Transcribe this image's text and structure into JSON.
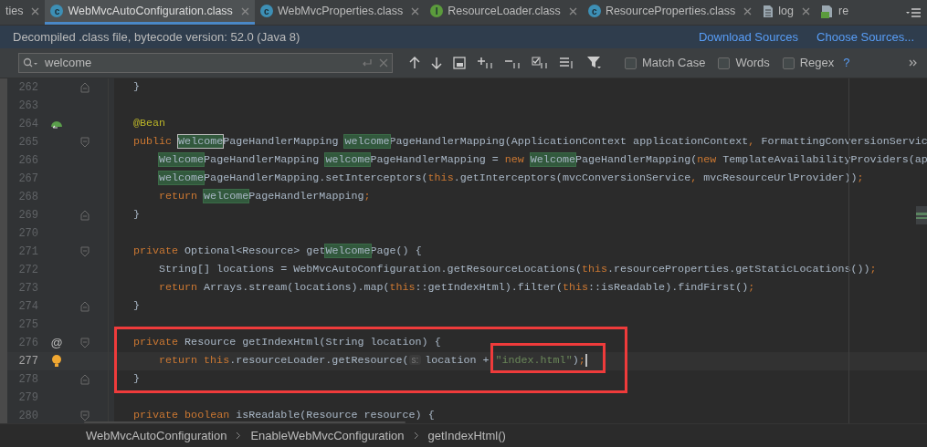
{
  "tabs": [
    {
      "label": "ties",
      "kind": "none",
      "selected": false
    },
    {
      "label": "WebMvcAutoConfiguration.class",
      "kind": "class",
      "icon_letter": "c",
      "selected": true
    },
    {
      "label": "WebMvcProperties.class",
      "kind": "class",
      "icon_letter": "c",
      "selected": false
    },
    {
      "label": "ResourceLoader.class",
      "kind": "interface",
      "icon_letter": "I",
      "selected": false
    },
    {
      "label": "ResourceProperties.class",
      "kind": "class",
      "icon_letter": "c",
      "selected": false
    },
    {
      "label": "log",
      "kind": "file",
      "selected": false
    },
    {
      "label": "re",
      "kind": "html",
      "selected": false
    }
  ],
  "info_bar": {
    "message": "Decompiled .class file, bytecode version: 52.0 (Java 8)",
    "links": [
      "Download Sources",
      "Choose Sources..."
    ]
  },
  "search": {
    "value": "welcome",
    "options": [
      {
        "label": "Match Case",
        "checked": false
      },
      {
        "label": "Words",
        "checked": false
      },
      {
        "label": "Regex",
        "checked": false
      }
    ],
    "help": "?"
  },
  "lines": [
    {
      "number": "262",
      "fold": {
        "kind": "end"
      },
      "segments": [
        {
          "kind": "plain",
          "text": "}"
        }
      ]
    },
    {
      "number": "263"
    },
    {
      "number": "264",
      "marker": {
        "kind": "bean"
      },
      "segments": [
        {
          "kind": "annotation",
          "text": "@Bean"
        }
      ]
    },
    {
      "number": "265",
      "fold": {
        "kind": "start"
      },
      "segments": [
        {
          "kind": "keyword",
          "text": "public "
        },
        {
          "kind": "match_current",
          "text": "Welcome"
        },
        {
          "kind": "plain",
          "text": "PageHandlerMapping "
        },
        {
          "kind": "match",
          "text": "welcome"
        },
        {
          "kind": "plain",
          "text": "PageHandlerMapping(ApplicationContext applicationContext"
        },
        {
          "kind": "keyword",
          "text": ", "
        },
        {
          "kind": "plain",
          "text": "FormattingConversionServic"
        }
      ]
    },
    {
      "number": "266",
      "indented": true,
      "segments": [
        {
          "kind": "match",
          "text": "Welcome"
        },
        {
          "kind": "plain",
          "text": "PageHandlerMapping "
        },
        {
          "kind": "match",
          "text": "welcome"
        },
        {
          "kind": "plain",
          "text": "PageHandlerMapping = "
        },
        {
          "kind": "keyword",
          "text": "new "
        },
        {
          "kind": "match",
          "text": "Welcome"
        },
        {
          "kind": "plain",
          "text": "PageHandlerMapping("
        },
        {
          "kind": "keyword",
          "text": "new "
        },
        {
          "kind": "plain",
          "text": "TemplateAvailabilityProviders(ap"
        }
      ]
    },
    {
      "number": "267",
      "indented": true,
      "segments": [
        {
          "kind": "match",
          "text": "welcome"
        },
        {
          "kind": "plain",
          "text": "PageHandlerMapping.setInterceptors("
        },
        {
          "kind": "keyword",
          "text": "this"
        },
        {
          "kind": "plain",
          "text": ".getInterceptors(mvcConversionService"
        },
        {
          "kind": "keyword",
          "text": ", "
        },
        {
          "kind": "plain",
          "text": "mvcResourceUrlProvider))"
        },
        {
          "kind": "keyword",
          "text": ";"
        }
      ]
    },
    {
      "number": "268",
      "indented": true,
      "segments": [
        {
          "kind": "keyword",
          "text": "return "
        },
        {
          "kind": "match",
          "text": "welcome"
        },
        {
          "kind": "plain",
          "text": "PageHandlerMapping"
        },
        {
          "kind": "keyword",
          "text": ";"
        }
      ]
    },
    {
      "number": "269",
      "fold": {
        "kind": "end"
      },
      "segments": [
        {
          "kind": "plain",
          "text": "}"
        }
      ]
    },
    {
      "number": "270"
    },
    {
      "number": "271",
      "fold": {
        "kind": "start"
      },
      "segments": [
        {
          "kind": "keyword",
          "text": "private "
        },
        {
          "kind": "plain",
          "text": "Optional<Resource> get"
        },
        {
          "kind": "match",
          "text": "Welcome"
        },
        {
          "kind": "plain",
          "text": "Page() {"
        }
      ]
    },
    {
      "number": "272",
      "indented": true,
      "segments": [
        {
          "kind": "plain",
          "text": "String[] locations = WebMvcAutoConfiguration.getResourceLocations("
        },
        {
          "kind": "keyword",
          "text": "this"
        },
        {
          "kind": "plain",
          "text": ".resourceProperties.getStaticLocations())"
        },
        {
          "kind": "keyword",
          "text": ";"
        }
      ]
    },
    {
      "number": "273",
      "indented": true,
      "segments": [
        {
          "kind": "keyword",
          "text": "return "
        },
        {
          "kind": "plain",
          "text": "Arrays.stream(locations).map("
        },
        {
          "kind": "keyword",
          "text": "this"
        },
        {
          "kind": "plain",
          "text": "::getIndexHtml).filter("
        },
        {
          "kind": "keyword",
          "text": "this"
        },
        {
          "kind": "plain",
          "text": "::isReadable).findFirst()"
        },
        {
          "kind": "keyword",
          "text": ";"
        }
      ]
    },
    {
      "number": "274",
      "fold": {
        "kind": "end"
      },
      "segments": [
        {
          "kind": "plain",
          "text": "}"
        }
      ]
    },
    {
      "number": "275"
    },
    {
      "number": "276",
      "marker": {
        "kind": "at",
        "text": "@"
      },
      "fold": {
        "kind": "start"
      },
      "segments": [
        {
          "kind": "keyword",
          "text": "private "
        },
        {
          "kind": "plain",
          "text": "Resource getIndexHtml(String location) {"
        }
      ]
    },
    {
      "number": "277",
      "marker": {
        "kind": "bulb"
      },
      "current": true,
      "indented": true,
      "segments": [
        {
          "kind": "keyword",
          "text": "return this"
        },
        {
          "kind": "plain",
          "text": ".resourceLoader.getResource("
        },
        {
          "kind": "hint",
          "text": "s:"
        },
        {
          "kind": "plain",
          "text": "location + "
        },
        {
          "kind": "string",
          "text": "\"index.html\""
        },
        {
          "kind": "plain",
          "text": ")"
        },
        {
          "kind": "keyword",
          "text": ";"
        }
      ]
    },
    {
      "number": "278",
      "fold": {
        "kind": "end"
      },
      "segments": [
        {
          "kind": "plain",
          "text": "}"
        }
      ]
    },
    {
      "number": "279"
    },
    {
      "number": "280",
      "fold": {
        "kind": "start"
      },
      "segments": [
        {
          "kind": "keyword",
          "text": "private boolean "
        },
        {
          "kind": "plain",
          "text": "isReadable(Resource resource) {"
        }
      ]
    }
  ],
  "breadcrumbs": [
    "WebMvcAutoConfiguration",
    "EnableWebMvcConfiguration",
    "getIndexHtml()"
  ]
}
